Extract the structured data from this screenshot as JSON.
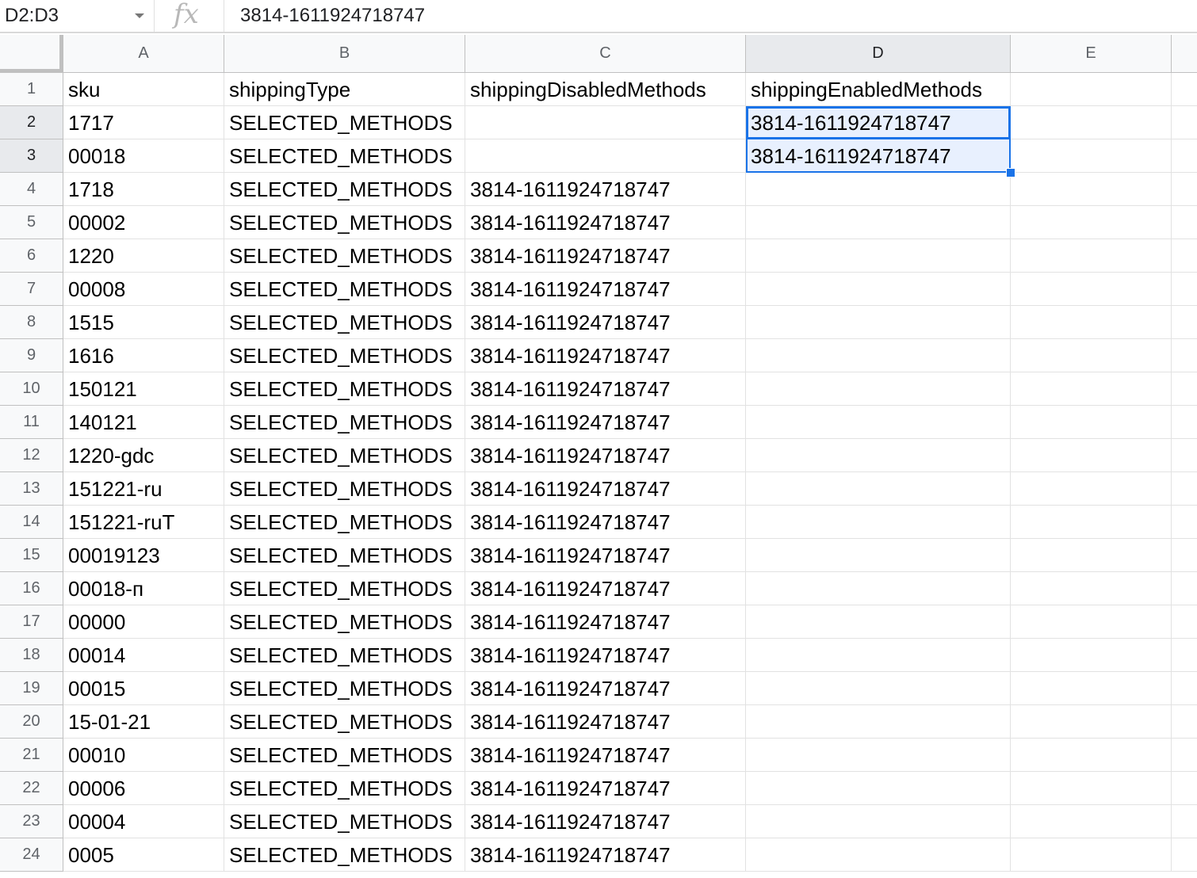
{
  "formula_bar": {
    "name_box": "D2:D3",
    "fx_label": "fx",
    "formula": "3814-1611924718747"
  },
  "columns": [
    "A",
    "B",
    "C",
    "D",
    "E"
  ],
  "selection": {
    "range": "D2:D3",
    "column": "D",
    "rows": [
      2,
      3
    ]
  },
  "rows": [
    {
      "num": "1",
      "cells": [
        "sku",
        "shippingType",
        "shippingDisabledMethods",
        "shippingEnabledMethods",
        ""
      ]
    },
    {
      "num": "2",
      "cells": [
        "1717",
        "SELECTED_METHODS",
        "",
        "3814-1611924718747",
        ""
      ]
    },
    {
      "num": "3",
      "cells": [
        "00018",
        "SELECTED_METHODS",
        "",
        "3814-1611924718747",
        ""
      ]
    },
    {
      "num": "4",
      "cells": [
        "1718",
        "SELECTED_METHODS",
        "3814-1611924718747",
        "",
        ""
      ]
    },
    {
      "num": "5",
      "cells": [
        "00002",
        "SELECTED_METHODS",
        "3814-1611924718747",
        "",
        ""
      ]
    },
    {
      "num": "6",
      "cells": [
        "1220",
        "SELECTED_METHODS",
        "3814-1611924718747",
        "",
        ""
      ]
    },
    {
      "num": "7",
      "cells": [
        "00008",
        "SELECTED_METHODS",
        "3814-1611924718747",
        "",
        ""
      ]
    },
    {
      "num": "8",
      "cells": [
        "1515",
        "SELECTED_METHODS",
        "3814-1611924718747",
        "",
        ""
      ]
    },
    {
      "num": "9",
      "cells": [
        "1616",
        "SELECTED_METHODS",
        "3814-1611924718747",
        "",
        ""
      ]
    },
    {
      "num": "10",
      "cells": [
        "150121",
        "SELECTED_METHODS",
        "3814-1611924718747",
        "",
        ""
      ]
    },
    {
      "num": "11",
      "cells": [
        "140121",
        "SELECTED_METHODS",
        "3814-1611924718747",
        "",
        ""
      ]
    },
    {
      "num": "12",
      "cells": [
        "1220-gdc",
        "SELECTED_METHODS",
        "3814-1611924718747",
        "",
        ""
      ]
    },
    {
      "num": "13",
      "cells": [
        "151221-ru",
        "SELECTED_METHODS",
        "3814-1611924718747",
        "",
        ""
      ]
    },
    {
      "num": "14",
      "cells": [
        "151221-ruT",
        "SELECTED_METHODS",
        "3814-1611924718747",
        "",
        ""
      ]
    },
    {
      "num": "15",
      "cells": [
        "00019123",
        "SELECTED_METHODS",
        "3814-1611924718747",
        "",
        ""
      ]
    },
    {
      "num": "16",
      "cells": [
        "00018-п",
        "SELECTED_METHODS",
        "3814-1611924718747",
        "",
        ""
      ]
    },
    {
      "num": "17",
      "cells": [
        "00000",
        "SELECTED_METHODS",
        "3814-1611924718747",
        "",
        ""
      ]
    },
    {
      "num": "18",
      "cells": [
        "00014",
        "SELECTED_METHODS",
        "3814-1611924718747",
        "",
        ""
      ]
    },
    {
      "num": "19",
      "cells": [
        "00015",
        "SELECTED_METHODS",
        "3814-1611924718747",
        "",
        ""
      ]
    },
    {
      "num": "20",
      "cells": [
        "15-01-21",
        "SELECTED_METHODS",
        "3814-1611924718747",
        "",
        ""
      ]
    },
    {
      "num": "21",
      "cells": [
        "00010",
        "SELECTED_METHODS",
        "3814-1611924718747",
        "",
        ""
      ]
    },
    {
      "num": "22",
      "cells": [
        "00006",
        "SELECTED_METHODS",
        "3814-1611924718747",
        "",
        ""
      ]
    },
    {
      "num": "23",
      "cells": [
        "00004",
        "SELECTED_METHODS",
        "3814-1611924718747",
        "",
        ""
      ]
    },
    {
      "num": "24",
      "cells": [
        "0005",
        "SELECTED_METHODS",
        "3814-1611924718747",
        "",
        ""
      ]
    }
  ]
}
